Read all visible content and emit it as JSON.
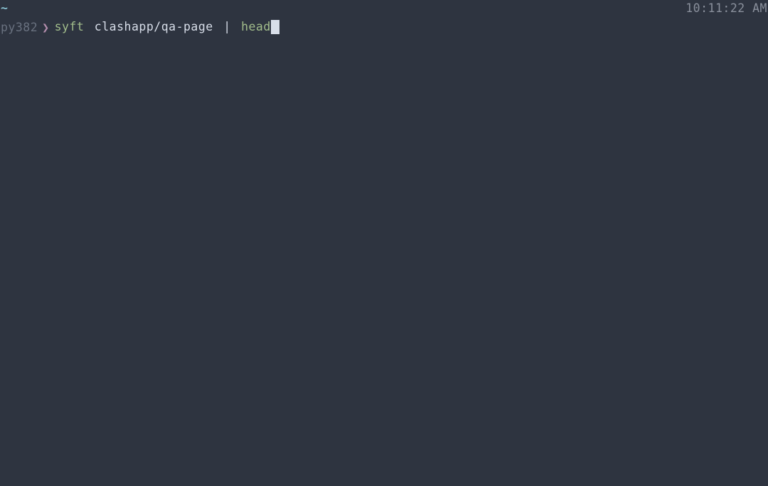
{
  "status": {
    "bufferIndicator": "~",
    "time": "10:11:22 AM"
  },
  "prompt": {
    "env": "py382",
    "arrow": "❯",
    "tokens": {
      "command1": "syft",
      "arg1": "clashapp/qa-page",
      "pipe": "|",
      "command2": "head"
    }
  }
}
